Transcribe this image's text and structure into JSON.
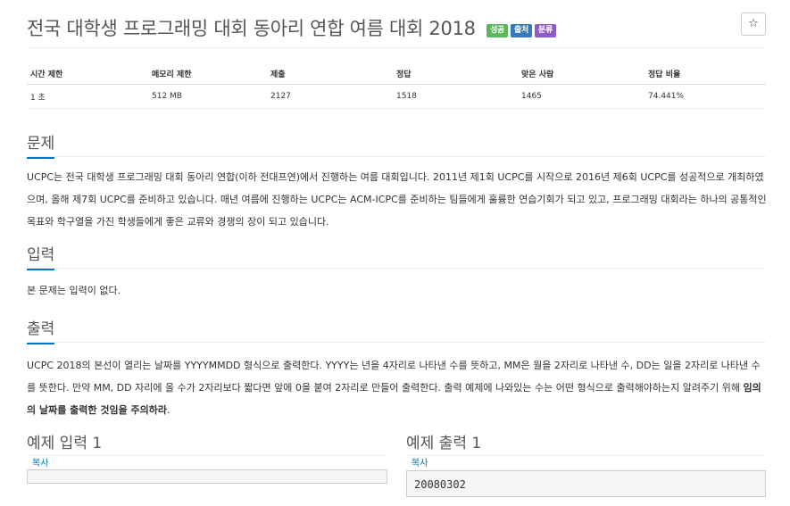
{
  "problem": {
    "title": "전국 대학생 프로그래밍 대회 동아리 연합 여름 대회 2018",
    "badges": [
      {
        "label": "성공",
        "color": "#5cb85c"
      },
      {
        "label": "출처",
        "color": "#337ab7"
      },
      {
        "label": "분류",
        "color": "#8e5cc7"
      }
    ],
    "star": "☆"
  },
  "stats": {
    "headers": [
      "시간 제한",
      "메모리 제한",
      "제출",
      "정답",
      "맞은 사람",
      "정답 비율"
    ],
    "values": [
      "1 초",
      "512 MB",
      "2127",
      "1518",
      "1465",
      "74.441%"
    ]
  },
  "sections": {
    "description_title": "문제",
    "description_text": "UCPC는 전국 대학생 프로그래밍 대회 동아리 연합(이하 전대프연)에서 진행하는 여름 대회입니다. 2011년 제1회 UCPC를 시작으로 2016년 제6회 UCPC를 성공적으로 개최하였으며, 올해 제7회 UCPC를 준비하고 있습니다. 매년 여름에 진행하는 UCPC는 ACM-ICPC를 준비하는 팀들에게 훌륭한 연습기회가 되고 있고, 프로그래밍 대회라는 하나의 공통적인 목표와 학구열을 가진 학생들에게 좋은 교류와 경쟁의 장이 되고 있습니다.",
    "input_title": "입력",
    "input_text": "본 문제는 입력이 없다.",
    "output_title": "출력",
    "output_text": "UCPC 2018의 본선이 열리는 날짜를 YYYYMMDD 형식으로 출력한다. YYYY는 년을 4자리로 나타낸 수를 뜻하고, MM은 월을 2자리로 나타낸 수, DD는 일을 2자리로 나타낸 수를 뜻한다. 만약 MM, DD 자리에 올 수가 2자리보다 짧다면 앞에 0을 붙여 2자리로 만들어 출력한다. 출력 예제에 나와있는 수는 어떤 형식으로 출력해야하는지 알려주기 위해 ",
    "output_bold": "임의의 날짜를 출력한 것임을 주의하라",
    "output_end": "."
  },
  "samples": {
    "input_title": "예제 입력 1",
    "output_title": "예제 출력 1",
    "copy_label": "복사",
    "input_value": "",
    "output_value": "20080302"
  }
}
